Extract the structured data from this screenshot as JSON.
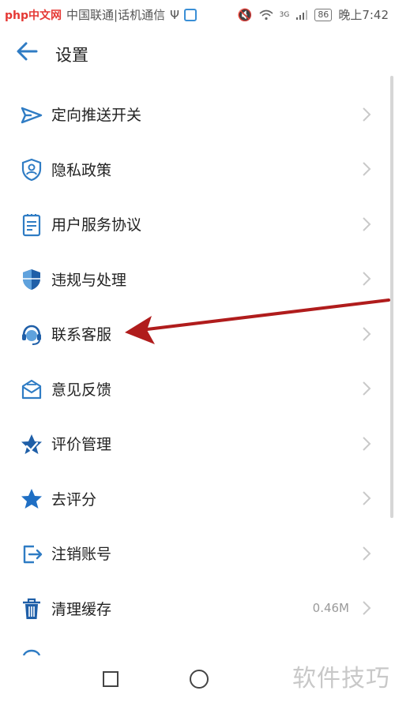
{
  "status_bar": {
    "watermark_logo": "php中文网",
    "carrier": "中国联通|话机通信",
    "network": "3G",
    "battery": "86",
    "time": "晚上7:42"
  },
  "header": {
    "title": "设置"
  },
  "settings_items": [
    {
      "label": "定向推送开关",
      "icon": "send-icon"
    },
    {
      "label": "隐私政策",
      "icon": "privacy-shield-icon"
    },
    {
      "label": "用户服务协议",
      "icon": "document-icon"
    },
    {
      "label": "违规与处理",
      "icon": "shield-icon"
    },
    {
      "label": "联系客服",
      "icon": "headset-icon"
    },
    {
      "label": "意见反馈",
      "icon": "mail-icon"
    },
    {
      "label": "评价管理",
      "icon": "star-outline-icon"
    },
    {
      "label": "去评分",
      "icon": "star-icon"
    },
    {
      "label": "注销账号",
      "icon": "logout-icon"
    },
    {
      "label": "清理缓存",
      "icon": "trash-icon",
      "value": "0.46M"
    }
  ],
  "nav_bar": {
    "watermark": "软件技巧"
  },
  "colors": {
    "accent": "#2f7cc4",
    "icon_dark": "#1f5fa8",
    "annotation_arrow": "#b01c1c"
  }
}
